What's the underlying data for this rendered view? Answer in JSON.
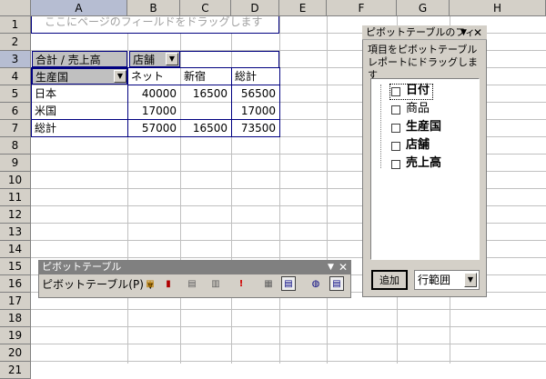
{
  "columns": [
    "A",
    "B",
    "C",
    "D",
    "E",
    "F",
    "G",
    "H"
  ],
  "rows": [
    "1",
    "2",
    "3",
    "4",
    "5",
    "6",
    "7",
    "8",
    "9",
    "10",
    "11",
    "12",
    "13",
    "14",
    "15",
    "16",
    "17",
    "18",
    "19",
    "20",
    "21"
  ],
  "drop_hint": "ここにページのフィールドをドラッグします",
  "pivot": {
    "data_label": "合計 / 売上高",
    "col_field": "店舗",
    "row_field": "生産国",
    "col_items": [
      "ネット",
      "新宿",
      "総計"
    ],
    "rows": [
      {
        "label": "日本",
        "values": [
          "40000",
          "16500",
          "56500"
        ]
      },
      {
        "label": "米国",
        "values": [
          "17000",
          "",
          "17000"
        ]
      },
      {
        "label": "総計",
        "values": [
          "57000",
          "16500",
          "73500"
        ]
      }
    ]
  },
  "field_list": {
    "title": "ピボットテーブルのフィ",
    "instruction": "項目をピボットテーブル レポートにドラッグします",
    "fields": [
      "日付",
      "商品",
      "生産国",
      "店舗",
      "売上高"
    ],
    "add_button": "追加",
    "area_select": "行範囲"
  },
  "toolbar": {
    "title": "ピボットテーブル",
    "menu_label": "ピボットテーブル(P)"
  },
  "colors": {
    "pivot_border": "#000080",
    "header_gray": "#d4d0c8",
    "selected_header": "#b6bdd2"
  },
  "icons": [
    "close-icon",
    "dropdown-arrow-icon",
    "chart-wizard-icon",
    "format-report-icon",
    "refresh-icon",
    "field-settings-icon"
  ]
}
